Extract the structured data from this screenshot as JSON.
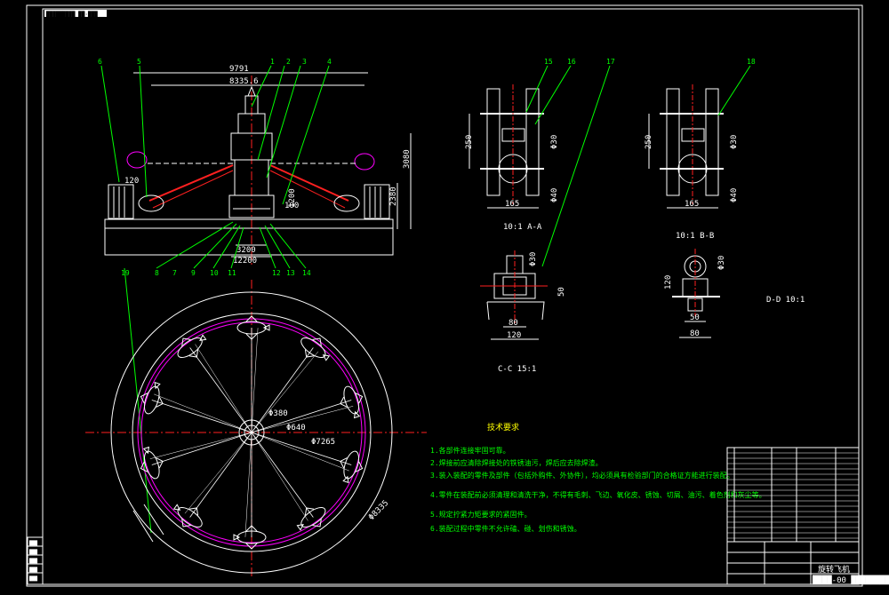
{
  "colors": {
    "background": "#000000",
    "frame": "#ffffff",
    "leader": "#00ff00",
    "centerline": "#ff2020",
    "track": "#ff00ff",
    "dimension": "#ffff00"
  },
  "header_stamp": "█████████ ██·███",
  "front_view": {
    "part_numbers": [
      "6",
      "5",
      "1",
      "2",
      "3",
      "4",
      "7",
      "8",
      "9",
      "10",
      "11",
      "12",
      "13",
      "14",
      "19"
    ],
    "dims": {
      "overall_width": "9791",
      "upper_width": "8335.6",
      "right_height": "3080",
      "right_height_b": "2380",
      "left_offset": "120",
      "center_width_a": "3200",
      "center_width_b": "12200",
      "center_height": "1200",
      "inner_height": "100"
    }
  },
  "plan_view": {
    "dims": {
      "inner_dia": "Φ380",
      "hub_dia": "Φ640",
      "wheel_dia": "Φ7265",
      "outer_dia": "Φ8335"
    }
  },
  "section_aa": {
    "part_numbers": [
      "15",
      "16",
      "17"
    ],
    "dim_h": "250",
    "dim_w": "165",
    "dia_a": "Φ30",
    "dia_b": "Φ40",
    "caption": "10:1 A-A"
  },
  "section_bb": {
    "part_numbers": [
      "18"
    ],
    "dim_h": "250",
    "dim_w": "165",
    "dia_a": "Φ30",
    "dia_b": "Φ40",
    "caption": "10:1 B-B"
  },
  "section_cc": {
    "dim_h": "50",
    "dim_w_a": "80",
    "dim_w_b": "120",
    "dia": "Φ30",
    "caption": "C-C 15:1"
  },
  "section_dd": {
    "dim_h": "120",
    "dim_w_a": "50",
    "dim_w_b": "80",
    "dia": "Φ30",
    "caption": "D-D 10:1"
  },
  "notes": {
    "title": "技术要求",
    "items": [
      "1.各部件连接牢固可靠。",
      "2.焊接前应清除焊接处的铁锈油污，焊后应去除焊渣。",
      "3.装入装配的零件及部件（包括外购件、外协件），均必须具有检验部门的合格证方能进行装配。",
      "4.零件在装配前必须清理和清洗干净，不得有毛刺、飞边、氧化皮、锈蚀、切屑、油污、着色剂和灰尘等。",
      "5.规定拧紧力矩要求的紧固件。",
      "6.装配过程中零件不允许磕、碰、划伤和锈蚀。"
    ]
  },
  "title_block": {
    "name": "旋转飞机",
    "drawing_no": "████-00 ████████ 0"
  },
  "revision_block": {
    "labels": [
      "███",
      "███",
      "███",
      "███",
      "███"
    ]
  }
}
